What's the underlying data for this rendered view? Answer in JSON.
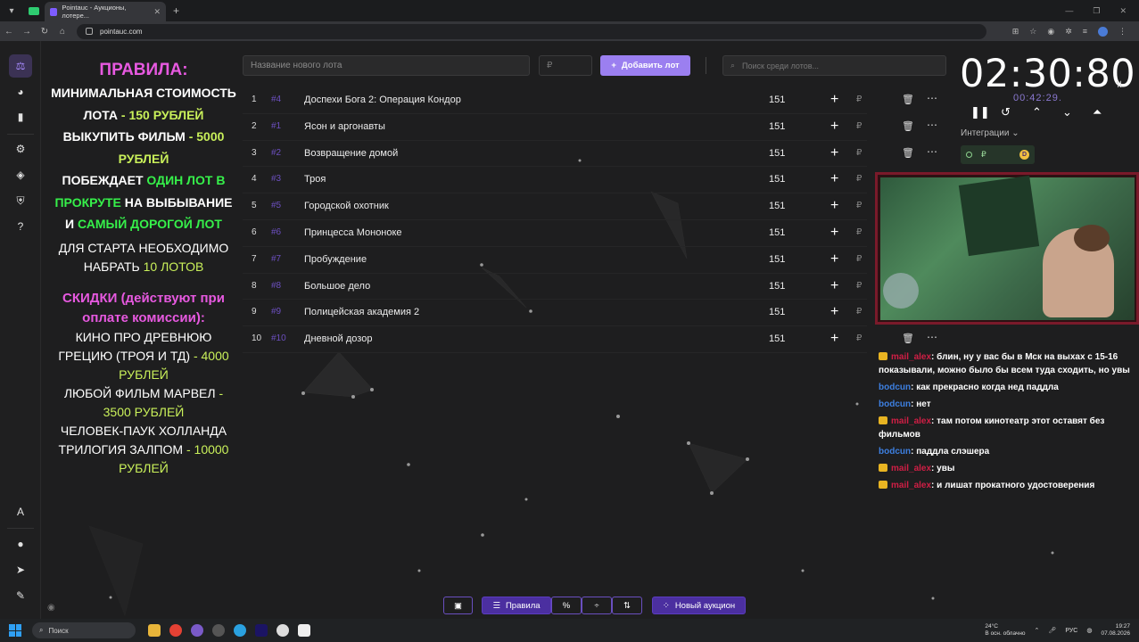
{
  "browser": {
    "tab_title": "Pointauc - Аукционы, лотере...",
    "url": "pointauc.com"
  },
  "rules": {
    "title": "ПРАВИЛА:",
    "line1": "МИНИМАЛЬНАЯ СТОИМОСТЬ ЛОТА",
    "line1_val": "- 150 РУБЛЕЙ",
    "line2": "ВЫКУПИТЬ ФИЛЬМ",
    "line2_val": "- 5000 РУБЛЕЙ",
    "line3a": "ПОБЕЖДАЕТ",
    "line3b": "ОДИН ЛОТ В ПРОКРУТЕ",
    "line3c": "НА ВЫБЫВАНИЕ И",
    "line3d": "САМЫЙ ДОРОГОЙ ЛОТ",
    "line4": "ДЛЯ СТАРТА НЕОБХОДИМО НАБРАТЬ",
    "line4_val": "10 ЛОТОВ",
    "discount_title": "СКИДКИ (действуют при оплате комиссии):",
    "d1": "КИНО ПРО ДРЕВНЮЮ ГРЕЦИЮ (ТРОЯ И ТД)",
    "d1_val": "- 4000 РУБЛЕЙ",
    "d2": "ЛЮБОЙ ФИЛЬМ МАРВЕЛ",
    "d2_val": "- 3500 РУБЛЕЙ",
    "d3": "ЧЕЛОВЕК-ПАУК ХОЛЛАНДА ТРИЛОГИЯ ЗАЛПОМ",
    "d3_val": "- 10000 РУБЛЕЙ"
  },
  "controls": {
    "new_lot_placeholder": "Название нового лота",
    "price_placeholder": "₽",
    "add_lot_label": "Добавить лот",
    "search_placeholder": "Поиск среди лотов..."
  },
  "lots": [
    {
      "num": "1",
      "fid": "#4",
      "name": "Доспехи Бога 2: Операция Кондор",
      "amount": "151",
      "trash": true
    },
    {
      "num": "2",
      "fid": "#1",
      "name": "Ясон и аргонавты",
      "amount": "151",
      "trash": true
    },
    {
      "num": "3",
      "fid": "#2",
      "name": "Возвращение домой",
      "amount": "151",
      "trash": true
    },
    {
      "num": "4",
      "fid": "#3",
      "name": "Троя",
      "amount": "151",
      "trash": false
    },
    {
      "num": "5",
      "fid": "#5",
      "name": "Городской охотник",
      "amount": "151",
      "trash": false
    },
    {
      "num": "6",
      "fid": "#6",
      "name": "Принцесса Мононоке",
      "amount": "151",
      "trash": false
    },
    {
      "num": "7",
      "fid": "#7",
      "name": "Пробуждение",
      "amount": "151",
      "trash": false
    },
    {
      "num": "8",
      "fid": "#8",
      "name": "Большое дело",
      "amount": "151",
      "trash": false
    },
    {
      "num": "9",
      "fid": "#9",
      "name": "Полицейская академия 2",
      "amount": "151",
      "trash": false
    },
    {
      "num": "10",
      "fid": "#10",
      "name": "Дневной дозор",
      "amount": "151",
      "trash": true
    }
  ],
  "rub_sign": "₽",
  "timer": {
    "main": "02:30:80",
    "sub": "00:42:29."
  },
  "integrations": {
    "label": "Интеграции",
    "coin": "₽",
    "d_badge": "D"
  },
  "chat": [
    {
      "user": "mail_alex",
      "color": "red",
      "crown": true,
      "text": ": блин, ну у вас бы в Мск на выхах с 15-16 показывали, можно было бы всем туда сходить, но увы"
    },
    {
      "user": "bodcun",
      "color": "blue",
      "crown": false,
      "text": ": как прекрасно когда нед паддла"
    },
    {
      "user": "bodcun",
      "color": "blue",
      "crown": false,
      "text": ": нет"
    },
    {
      "user": "mail_alex",
      "color": "red",
      "crown": true,
      "text": ": там потом кинотеатр этот оставят без фильмов"
    },
    {
      "user": "bodcun",
      "color": "blue",
      "crown": false,
      "text": ": паддла слэшера"
    },
    {
      "user": "mail_alex",
      "color": "red",
      "crown": true,
      "text": ": увы"
    },
    {
      "user": "mail_alex",
      "color": "red",
      "crown": true,
      "text": ": и лишат прокатного удостоверения"
    }
  ],
  "bottom": {
    "rules_label": "Правила",
    "percent": "%",
    "new_auction_label": "Новый аукцион"
  },
  "taskbar": {
    "search": "Поиск",
    "temp": "24°C",
    "weather": "В осн. облачно",
    "lang": "РУС",
    "time": "19:27",
    "date": "07.08.2026"
  }
}
